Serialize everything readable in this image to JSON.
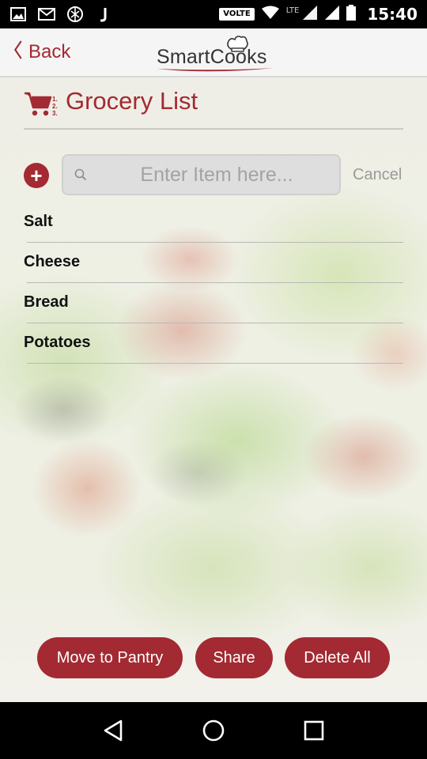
{
  "status_bar": {
    "volte": "VOLTE",
    "lte": "LTE",
    "time": "15:40",
    "icons": [
      "image-icon",
      "gmail-icon",
      "app-icon",
      "j-icon",
      "wifi-icon",
      "signal-icon",
      "signal-icon",
      "battery-icon"
    ]
  },
  "header": {
    "back_label": "Back",
    "logo_text_1": "Smart",
    "logo_text_2": "Cooks"
  },
  "page": {
    "title": "Grocery List"
  },
  "search": {
    "placeholder": "Enter Item here...",
    "value": "",
    "cancel_label": "Cancel",
    "add_label": "+"
  },
  "items": [
    {
      "label": "Salt"
    },
    {
      "label": "Cheese"
    },
    {
      "label": "Bread"
    },
    {
      "label": "Potatoes"
    }
  ],
  "actions": {
    "move_to_pantry": "Move to Pantry",
    "share": "Share",
    "delete_all": "Delete All"
  },
  "colors": {
    "accent": "#a32a32"
  }
}
